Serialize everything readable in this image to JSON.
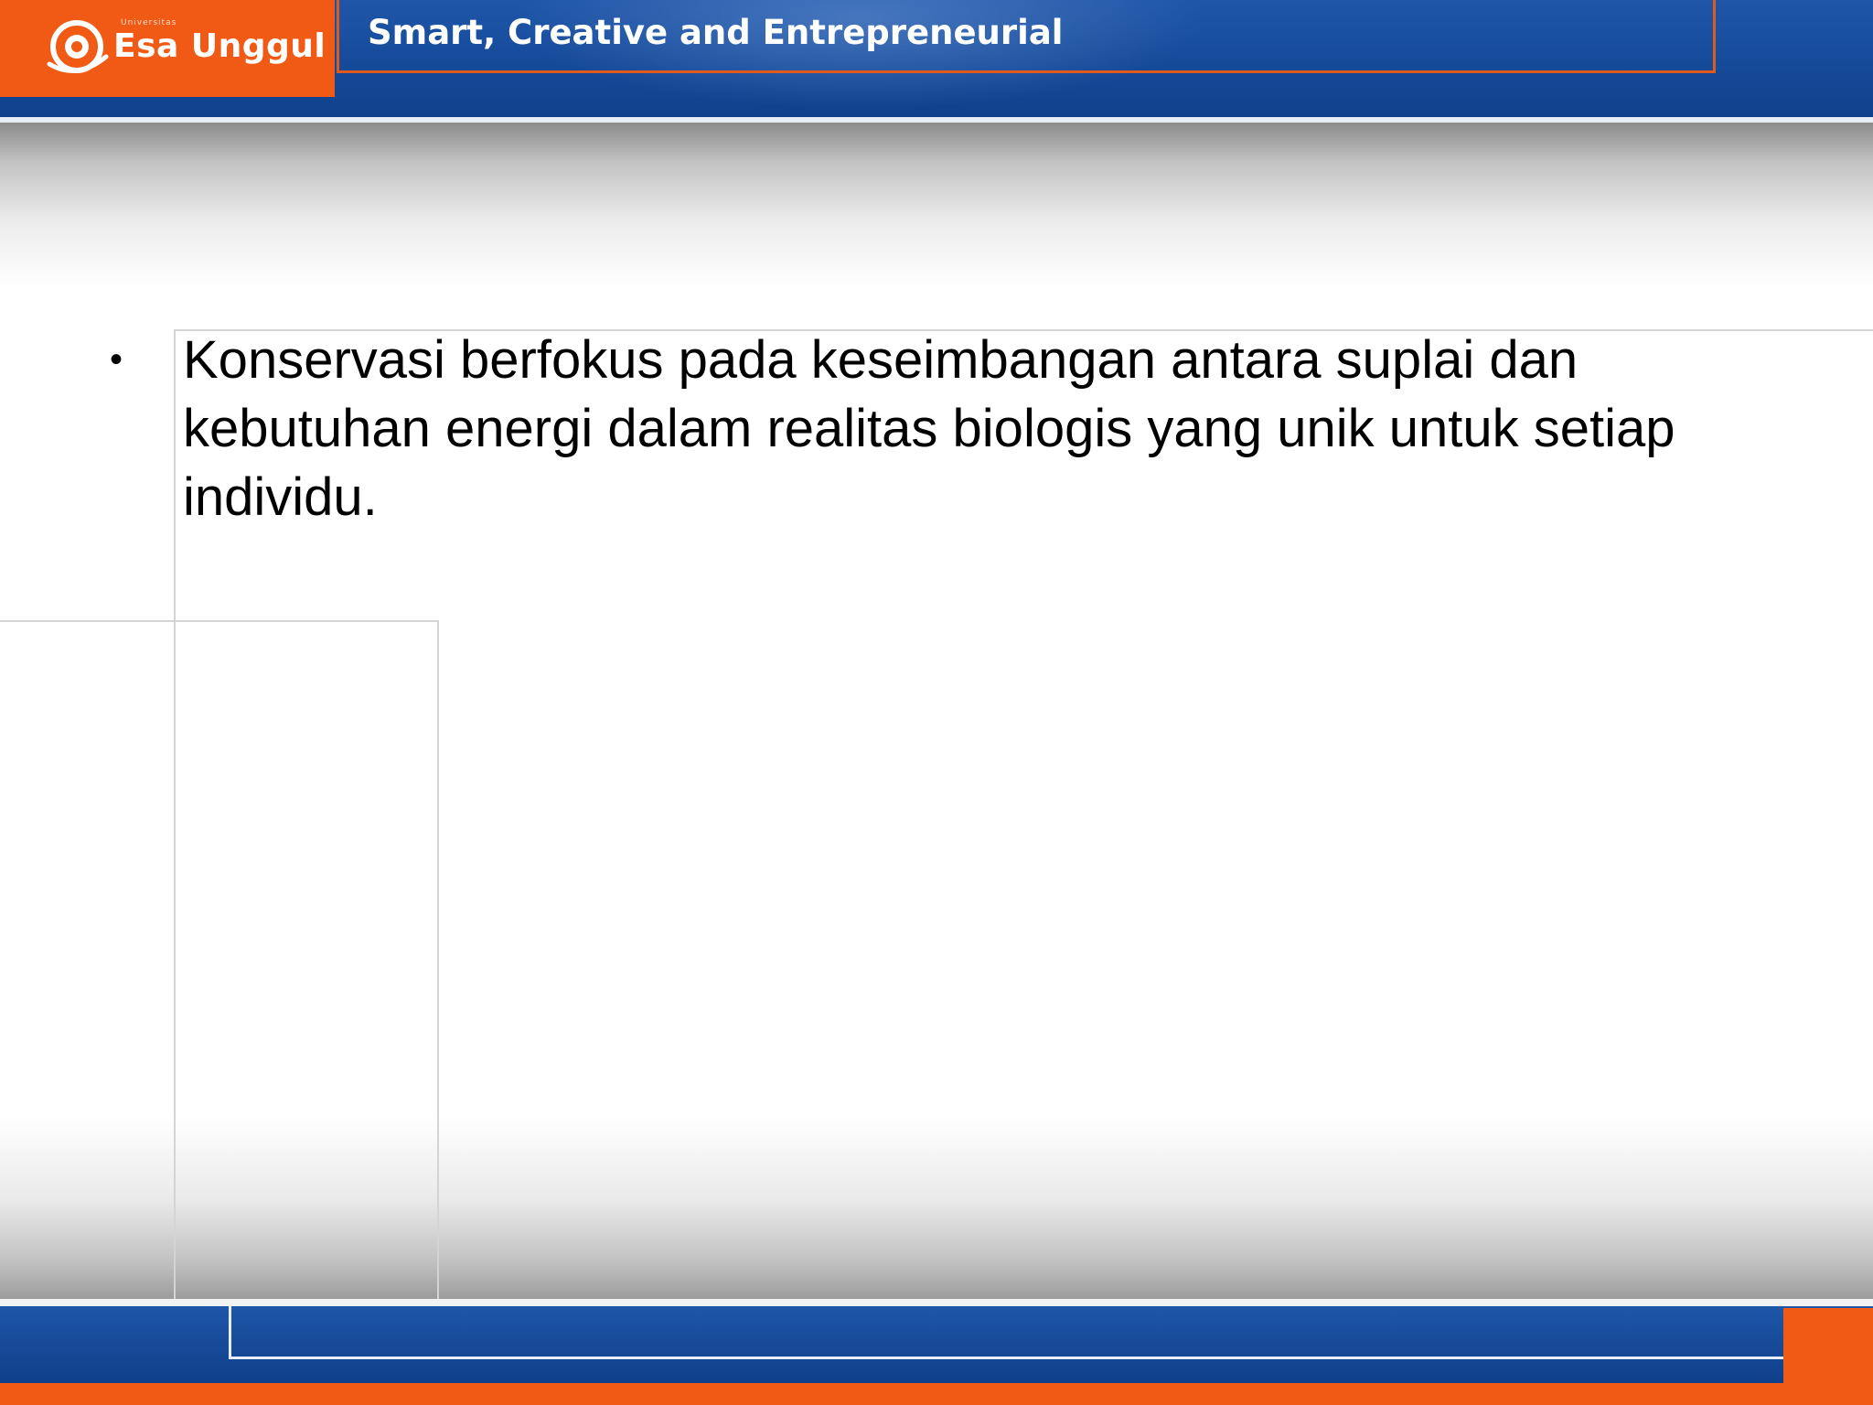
{
  "header": {
    "logo_small": "Universitas",
    "logo_name": "Esa Unggul",
    "tagline": "Smart, Creative and Entrepreneurial"
  },
  "content": {
    "bullets": [
      {
        "marker": "•",
        "text": "Konservasi berfokus pada keseimbangan antara suplai dan kebutuhan energi dalam realitas biologis yang unik untuk setiap individu."
      }
    ]
  },
  "colors": {
    "brand_orange": "#f05a14",
    "brand_blue": "#154a99"
  }
}
